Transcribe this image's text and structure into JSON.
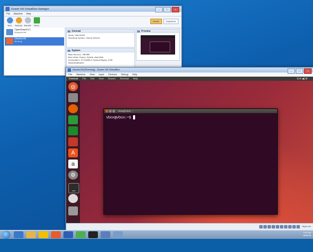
{
  "manager": {
    "title": "Oracle VM VirtualBox Manager",
    "menu": [
      "File",
      "Machine",
      "Help"
    ],
    "toolbar": [
      "New",
      "Settings",
      "Discard",
      "Show"
    ],
    "view_buttons": [
      "Details",
      "Snapshots"
    ],
    "vms": [
      {
        "name": "OpenSuse13.2",
        "state": "Powered Off"
      },
      {
        "name": "UbuntuVM",
        "state": "Running"
      }
    ],
    "general": {
      "header": "General",
      "lines": [
        "Name:  UbuntuVM",
        "Operating System:  Ubuntu (64-bit)"
      ]
    },
    "system": {
      "header": "System",
      "lines": [
        "Base Memory:  768 MB",
        "Boot Order:  Floppy, Optical, Hard Disk",
        "Acceleration:  VT-x/AMD-V, Nested Paging, KVM",
        "Paravirtualization"
      ]
    },
    "preview_header": "Preview"
  },
  "vm_window": {
    "title": "UbuntuVM [Running] - Oracle VM VirtualBox",
    "menu": [
      "File",
      "Machine",
      "View",
      "Input",
      "Devices",
      "Debug",
      "Help"
    ],
    "host_key": "Right Ctrl"
  },
  "guest": {
    "panel_menu": [
      "Terminal",
      "File",
      "Edit",
      "View",
      "Search",
      "Terminal",
      "Help"
    ],
    "panel_right": "⇅  ✉  ◀)  ⚙",
    "terminal": {
      "title": "vbox@vbox: ~",
      "prompt": "vbox@vbox:~$ "
    }
  },
  "taskbar": {
    "clock_line1": "7:01 PM",
    "clock_line2": "Build 95"
  }
}
